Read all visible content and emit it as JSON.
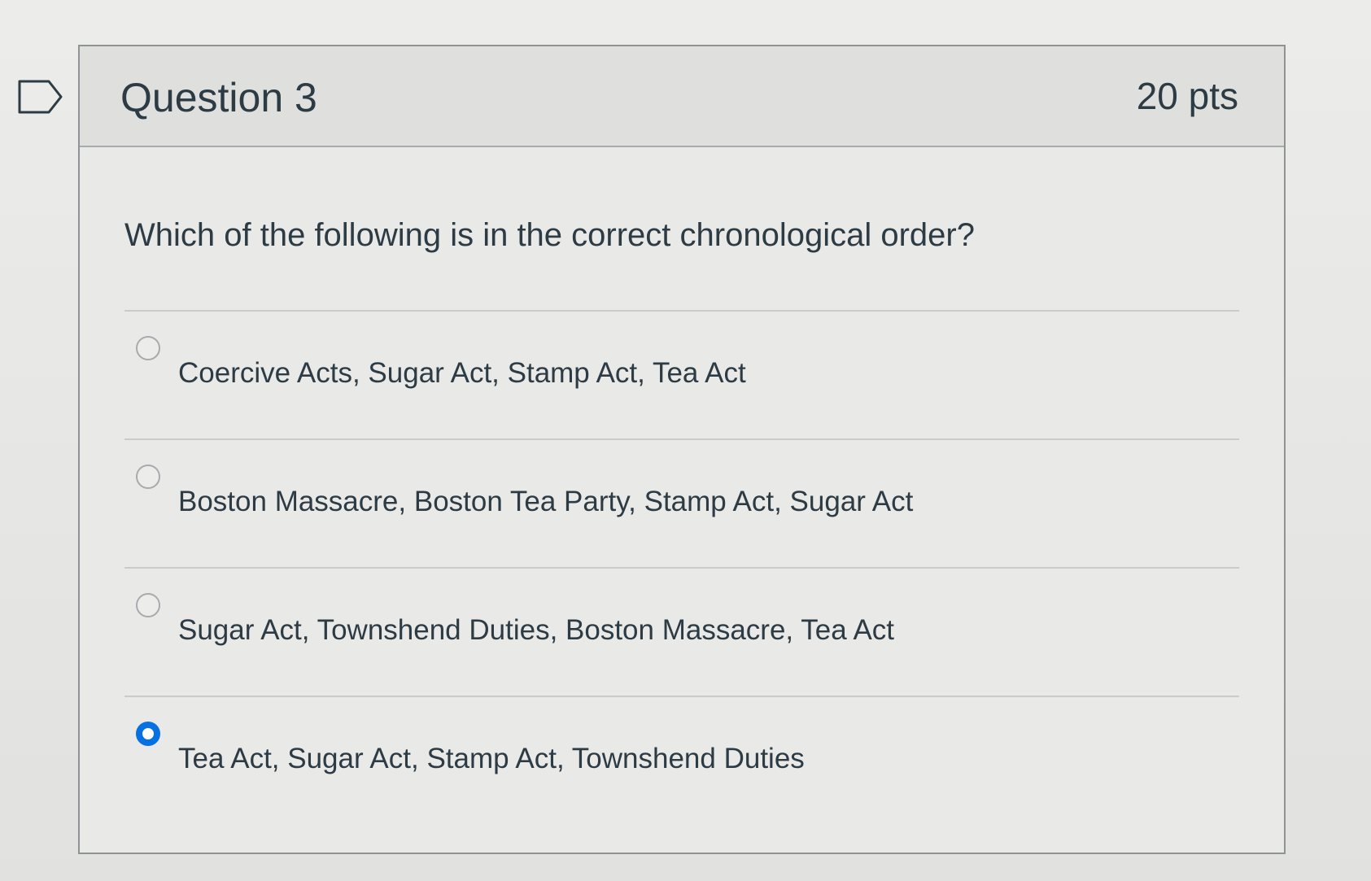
{
  "question": {
    "title": "Question 3",
    "points": "20 pts",
    "text": "Which of the following is in the correct chronological order?",
    "answers": [
      {
        "label": "Coercive Acts, Sugar Act, Stamp Act, Tea Act",
        "selected": false
      },
      {
        "label": "Boston Massacre, Boston Tea Party, Stamp Act, Sugar Act",
        "selected": false
      },
      {
        "label": "Sugar Act, Townshend Duties, Boston Massacre, Tea Act",
        "selected": false
      },
      {
        "label": "Tea Act, Sugar Act, Stamp Act, Townshend Duties",
        "selected": true
      }
    ]
  },
  "colors": {
    "selected_radio": "#0770e3",
    "text": "#2d3b45",
    "header_bg": "#dfe0de",
    "border": "#8f9395"
  },
  "icons": {
    "flag": "flag-outline-icon"
  }
}
